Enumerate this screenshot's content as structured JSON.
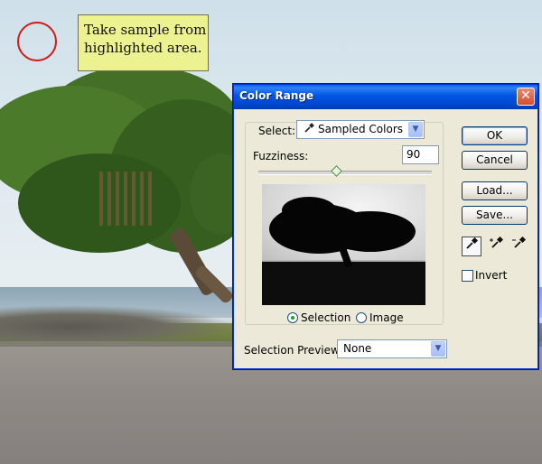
{
  "annotation": {
    "callout_text": "Take sample from highlighted area."
  },
  "dialog": {
    "title": "Color Range",
    "close_glyph": "✕",
    "select_label": "Select:",
    "select_value": "Sampled Colors",
    "select_icon": "eyedropper-icon",
    "fuzziness_label": "Fuzziness:",
    "fuzziness_value": "90",
    "fuzziness_slider_fraction": 0.45,
    "view_options": [
      {
        "label": "Selection",
        "selected": true
      },
      {
        "label": "Image",
        "selected": false
      }
    ],
    "selection_preview_label": "Selection Preview:",
    "selection_preview_value": "None",
    "buttons": {
      "ok": "OK",
      "cancel": "Cancel",
      "load": "Load...",
      "save": "Save..."
    },
    "tools": [
      "eyedropper-icon",
      "eyedropper-plus-icon",
      "eyedropper-minus-icon"
    ],
    "invert_label": "Invert",
    "invert_checked": false
  },
  "colors": {
    "titlebar": "#0054e3",
    "dialog_face": "#ece9d8",
    "callout_bg": "#ecf28f",
    "marker": "#d11a1a"
  }
}
